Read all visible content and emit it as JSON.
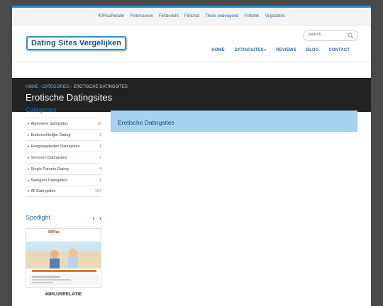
{
  "topnav": [
    "40PlusRelatie",
    "Flirtvrouwen",
    "Flirtbericht",
    "Flirtchat",
    "Tikkie ondeugend",
    "Flirtplek",
    "Vegadates"
  ],
  "header": {
    "logo": "Dating Sites Vergelijken",
    "search_placeholder": "Search...",
    "nav": [
      "HOME",
      "DATINGSITES",
      "REVIEWS",
      "BLOG",
      "CONTACT"
    ]
  },
  "banner": {
    "breadcrumb": [
      "HOME",
      "CATEGORIES",
      "EROTISCHE DATINGSITES"
    ],
    "title": "Erotische Datingsites"
  },
  "sidebar": {
    "categories_title": "Categories",
    "categories": [
      {
        "label": "Algemene datingsites",
        "count": "19"
      },
      {
        "label": "Buitenechtelijke Dating",
        "count": "3"
      },
      {
        "label": "Hoogopgeleiden Datingsites",
        "count": "1"
      },
      {
        "label": "Senioren Datingsites",
        "count": "2"
      },
      {
        "label": "Single Parents Dating",
        "count": "4"
      },
      {
        "label": "Swingers Datingsites",
        "count": "1"
      },
      {
        "label": "All Datingsites",
        "count": "157"
      }
    ],
    "spotlight_title": "Spotlight",
    "spotlight_item": "40PLUSRELATIE",
    "spotlight_logo": "40Plus"
  },
  "main": {
    "heading": "Erotische Datingsites"
  }
}
